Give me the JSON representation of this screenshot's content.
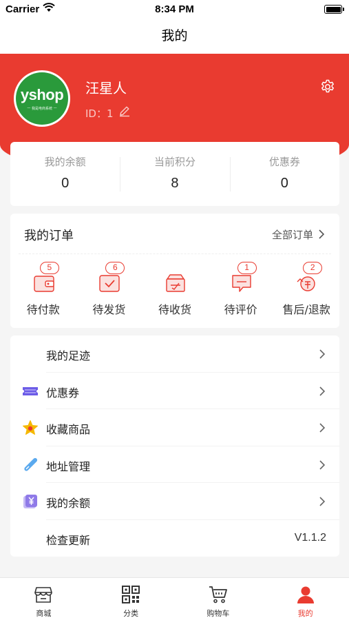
{
  "status_bar": {
    "carrier": "Carrier",
    "time": "8:34 PM"
  },
  "nav": {
    "title": "我的"
  },
  "profile": {
    "name": "汪星人",
    "id_text": "ID：1",
    "avatar": {
      "logo_text": "yshop",
      "logo_subtext": "一 我是电商系统 一"
    }
  },
  "stats": [
    {
      "label": "我的余额",
      "value": "0"
    },
    {
      "label": "当前积分",
      "value": "8"
    },
    {
      "label": "优惠券",
      "value": "0"
    }
  ],
  "orders": {
    "title": "我的订单",
    "all_link": "全部订单",
    "items": [
      {
        "label": "待付款",
        "badge": "5",
        "icon": "wallet-icon"
      },
      {
        "label": "待发货",
        "badge": "6",
        "icon": "package-check-icon"
      },
      {
        "label": "待收货",
        "badge": "",
        "icon": "delivery-box-icon"
      },
      {
        "label": "待评价",
        "badge": "1",
        "icon": "comment-icon"
      },
      {
        "label": "售后/退款",
        "badge": "2",
        "icon": "refund-icon"
      }
    ]
  },
  "menu": {
    "items": [
      {
        "label": "我的足迹",
        "icon": "",
        "right": "chevron"
      },
      {
        "label": "优惠券",
        "icon": "coupon-icon",
        "right": "chevron"
      },
      {
        "label": "收藏商品",
        "icon": "star-icon",
        "right": "chevron"
      },
      {
        "label": "地址管理",
        "icon": "address-icon",
        "right": "chevron"
      },
      {
        "label": "我的余额",
        "icon": "balance-icon",
        "right": "chevron"
      },
      {
        "label": "检查更新",
        "icon": "",
        "right_value": "V1.1.2"
      }
    ]
  },
  "tabs": [
    {
      "label": "商城",
      "icon": "store-icon",
      "active": false
    },
    {
      "label": "分类",
      "icon": "qrcode-icon",
      "active": false
    },
    {
      "label": "购物车",
      "icon": "cart-icon",
      "active": false
    },
    {
      "label": "我的",
      "icon": "user-icon",
      "active": true
    }
  ],
  "colors": {
    "brand": "#e93b30",
    "background": "#f5f5f5",
    "card": "#ffffff"
  }
}
